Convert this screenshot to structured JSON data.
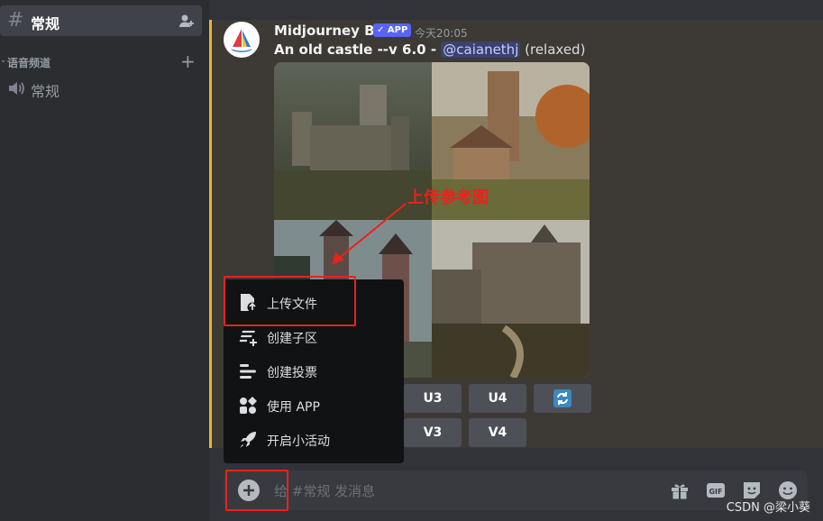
{
  "sidebar": {
    "active_channel": "常规",
    "category": "语音频道",
    "voice_channel": "常规"
  },
  "message": {
    "author": "Midjourney Bot",
    "app_badge": "APP",
    "timestamp": "今天20:05",
    "prompt": "An old castle --v 6.0",
    "separator": " - ",
    "mention": "@caianethj",
    "mode": " (relaxed)",
    "images": [
      "castle-1",
      "castle-2",
      "castle-3",
      "castle-4"
    ],
    "buttons_row1": [
      "U3",
      "U4"
    ],
    "buttons_row2": [
      "V3",
      "V4"
    ]
  },
  "annotation": "上传参考图",
  "menu": {
    "items": [
      {
        "label": "上传文件",
        "icon": "upload-file-icon"
      },
      {
        "label": "创建子区",
        "icon": "thread-icon"
      },
      {
        "label": "创建投票",
        "icon": "poll-icon"
      },
      {
        "label": "使用 APP",
        "icon": "apps-icon"
      },
      {
        "label": "开启小活动",
        "icon": "rocket-icon"
      }
    ]
  },
  "input": {
    "placeholder": "给 #常规 发消息"
  },
  "watermark": "CSDN @梁小葵",
  "colors": {
    "accent": "#5865f2",
    "annotation_red": "#e8231b",
    "highlight_bar": "#f0b232"
  }
}
